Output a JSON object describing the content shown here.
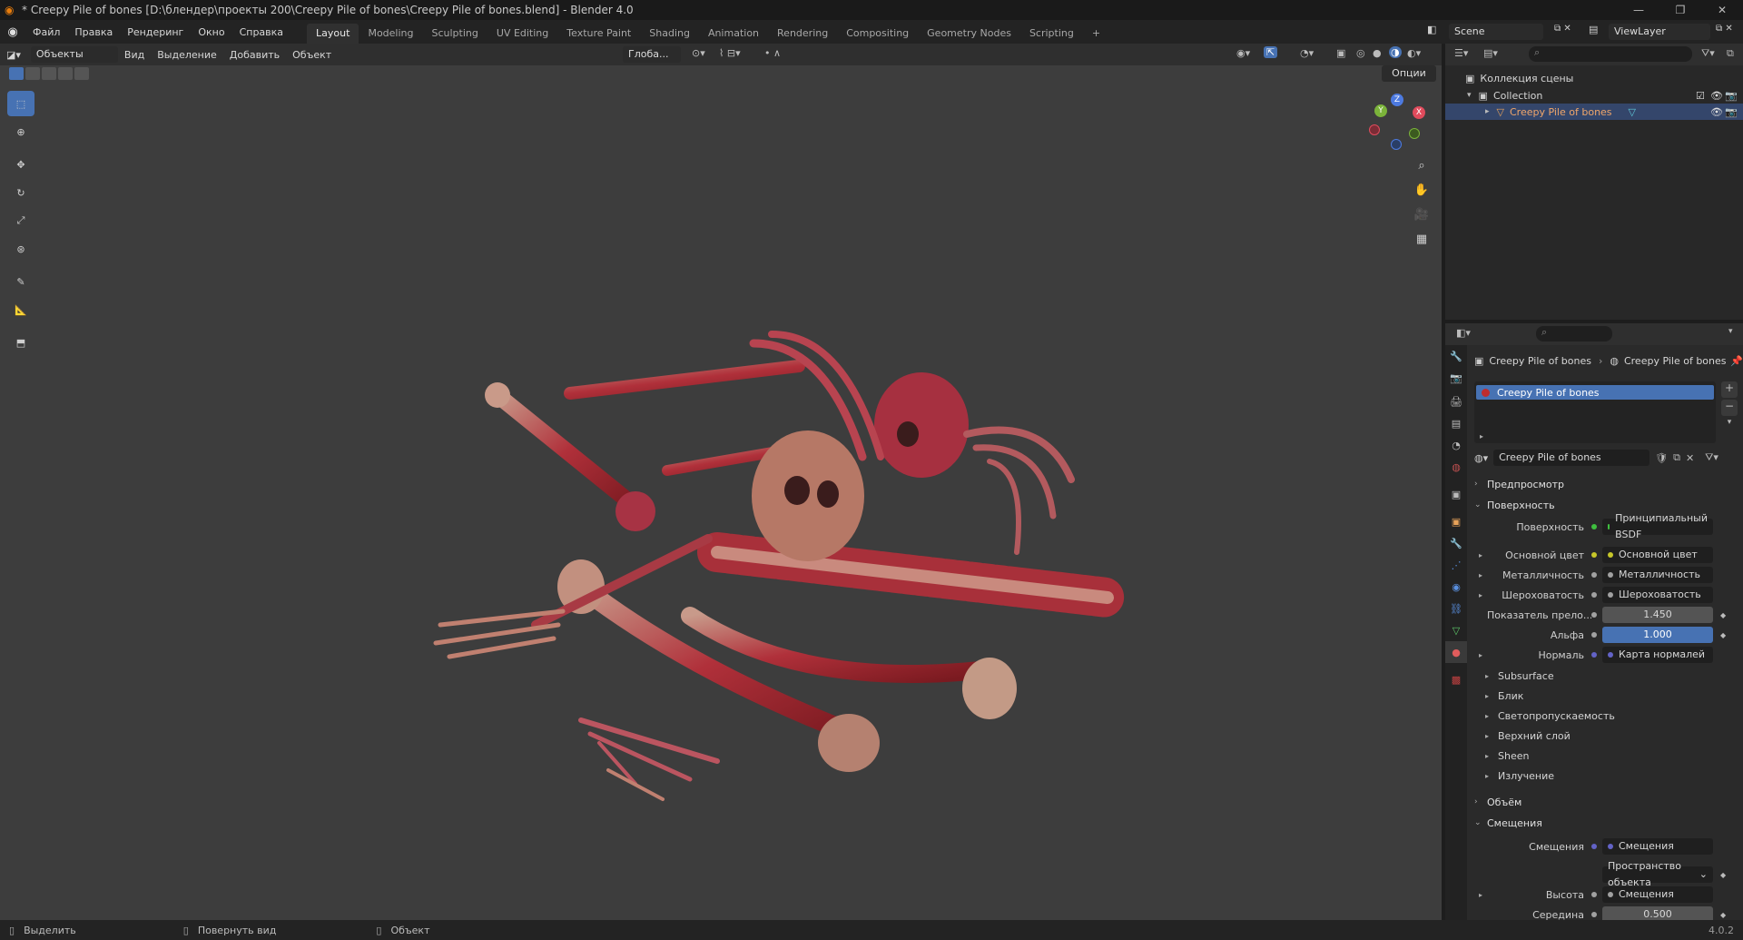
{
  "window": {
    "title": "* Creepy Pile of bones [D:\\блендер\\проекты 200\\Creepy Pile of bones\\Creepy Pile of bones.blend] - Blender 4.0",
    "minimize": "—",
    "restore": "❐",
    "close": "✕"
  },
  "menu": [
    "Файл",
    "Правка",
    "Рендеринг",
    "Окно",
    "Справка"
  ],
  "workspaces": [
    "Layout",
    "Modeling",
    "Sculpting",
    "UV Editing",
    "Texture Paint",
    "Shading",
    "Animation",
    "Rendering",
    "Compositing",
    "Geometry Nodes",
    "Scripting"
  ],
  "workspace_add": "+",
  "scene": {
    "name": "Scene",
    "view_layer": "ViewLayer"
  },
  "viewport_header": {
    "mode": "Объекты",
    "menus": [
      "Вид",
      "Выделение",
      "Добавить",
      "Объект"
    ],
    "transform_orientation": "Глоба...",
    "options": "Опции"
  },
  "gizmo": {
    "x": "X",
    "y": "Y",
    "z": "Z"
  },
  "outliner": {
    "root": "Коллекция сцены",
    "collection": "Collection",
    "object": "Creepy Pile of bones"
  },
  "properties": {
    "breadcrumb_object": "Creepy Pile of bones",
    "breadcrumb_material": "Creepy Pile of bones",
    "material_slot": "Creepy Pile of bones",
    "material_name": "Creepy Pile of bones",
    "sections": {
      "preview": "Предпросмотр",
      "surface": "Поверхность",
      "volume": "Объём",
      "displacement": "Смещения"
    },
    "surface_rows": [
      {
        "label": "Поверхность",
        "value": "Принципиальный BSDF",
        "dot": "#3fbf3f"
      },
      {
        "label": "Основной цвет",
        "value": "Основной цвет",
        "dot": "#c7c729",
        "expand": true
      },
      {
        "label": "Металличность",
        "value": "Металличность",
        "dot": "#a1a1a1",
        "expand": true
      },
      {
        "label": "Шероховатость",
        "value": "Шероховатость",
        "dot": "#a1a1a1",
        "expand": true
      },
      {
        "label": "Показатель прело...",
        "value": "1.450",
        "kind": "num"
      },
      {
        "label": "Альфа",
        "value": "1.000",
        "kind": "blue"
      },
      {
        "label": "Нормаль",
        "value": "Карта нормалей",
        "dot": "#6363c7",
        "expand": true
      }
    ],
    "subpanels": [
      "Subsurface",
      "Блик",
      "Светопропускаемость",
      "Верхний слой",
      "Sheen",
      "Излучение"
    ],
    "displacement_rows": [
      {
        "label": "Смещения",
        "value": "Смещения",
        "dot": "#6363c7"
      },
      {
        "label": "",
        "value": "Пространство объекта",
        "kind": "dropdown"
      },
      {
        "label": "Высота",
        "value": "Смещения",
        "dot": "#a1a1a1",
        "expand": true
      },
      {
        "label": "Середина",
        "value": "0.500",
        "kind": "num"
      }
    ]
  },
  "statusbar": {
    "select": "Выделить",
    "rotate": "Повернуть вид",
    "object": "Объект",
    "version": "4.0.2"
  }
}
